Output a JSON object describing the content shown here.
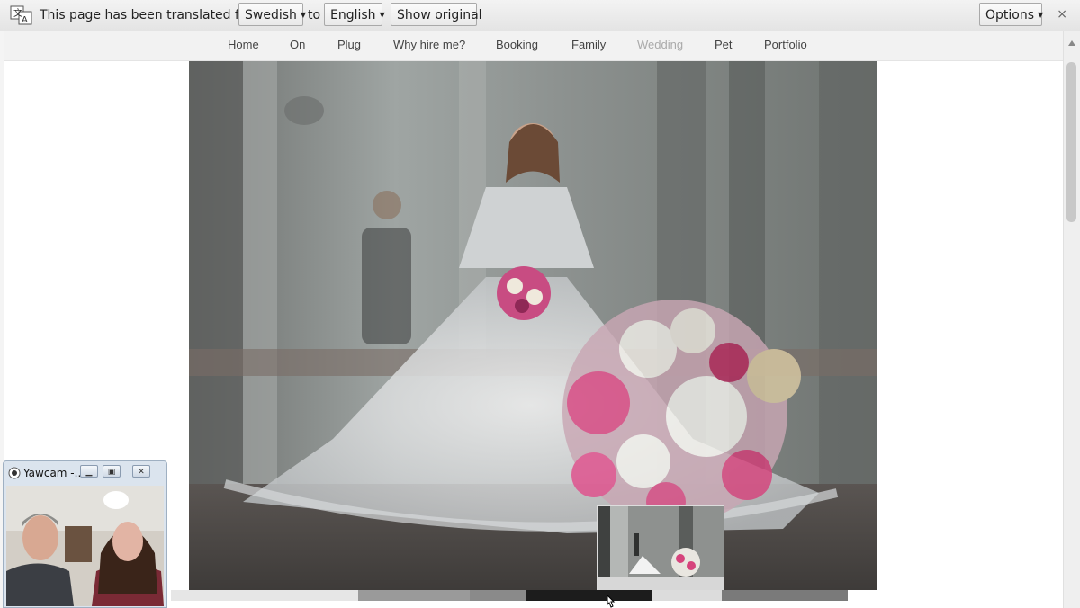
{
  "translate_bar": {
    "prefix": "This page has been translated from",
    "source_language": "Swedish",
    "connector": "to",
    "target_language": "English",
    "show_original": "Show original",
    "options": "Options",
    "close": "×"
  },
  "nav": {
    "items": [
      "Home",
      "On",
      "Plug",
      "Why hire me?",
      "Booking",
      "Family",
      "Wedding",
      "Pet",
      "Portfolio"
    ],
    "active": "Wedding"
  },
  "webcam": {
    "title": "Yawcam -..."
  }
}
